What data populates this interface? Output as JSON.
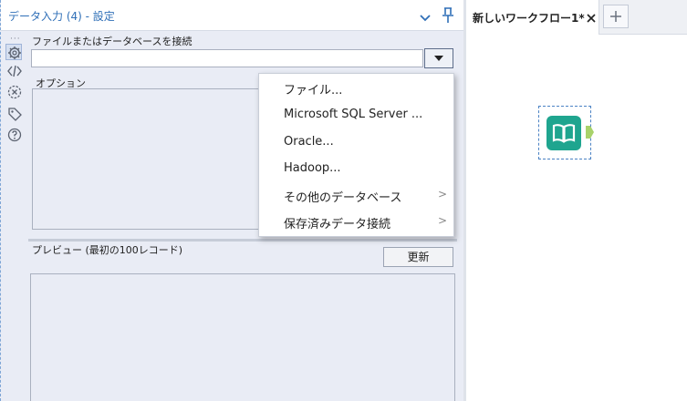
{
  "panel": {
    "title": "データ入力 (4) - 設定"
  },
  "toolstrip": {
    "icons": [
      "gear-icon",
      "code-icon",
      "annotation-icon",
      "tag-icon",
      "help-icon"
    ]
  },
  "connect": {
    "label": "ファイルまたはデータベースを接続",
    "value": ""
  },
  "options": {
    "label": "オプション"
  },
  "preview": {
    "label": "プレビュー (最初の100レコード)",
    "refresh_label": "更新"
  },
  "dropdown": {
    "items": [
      {
        "label": "ファイル...",
        "submenu": false
      },
      {
        "label": "Microsoft SQL Server ...",
        "submenu": false
      },
      {
        "label": "Oracle...",
        "submenu": false
      },
      {
        "label": "Hadoop...",
        "submenu": false
      },
      {
        "label": "その他のデータベース",
        "submenu": true,
        "arrow": ">"
      },
      {
        "label": "保存済みデータ接続",
        "submenu": true,
        "arrow": ">"
      }
    ]
  },
  "workflow": {
    "tab_label": "新しいワークフロー1*"
  },
  "colors": {
    "accent": "#2f6fb7",
    "tool_teal": "#1fa58f",
    "anchor_green": "#a8d26a"
  }
}
